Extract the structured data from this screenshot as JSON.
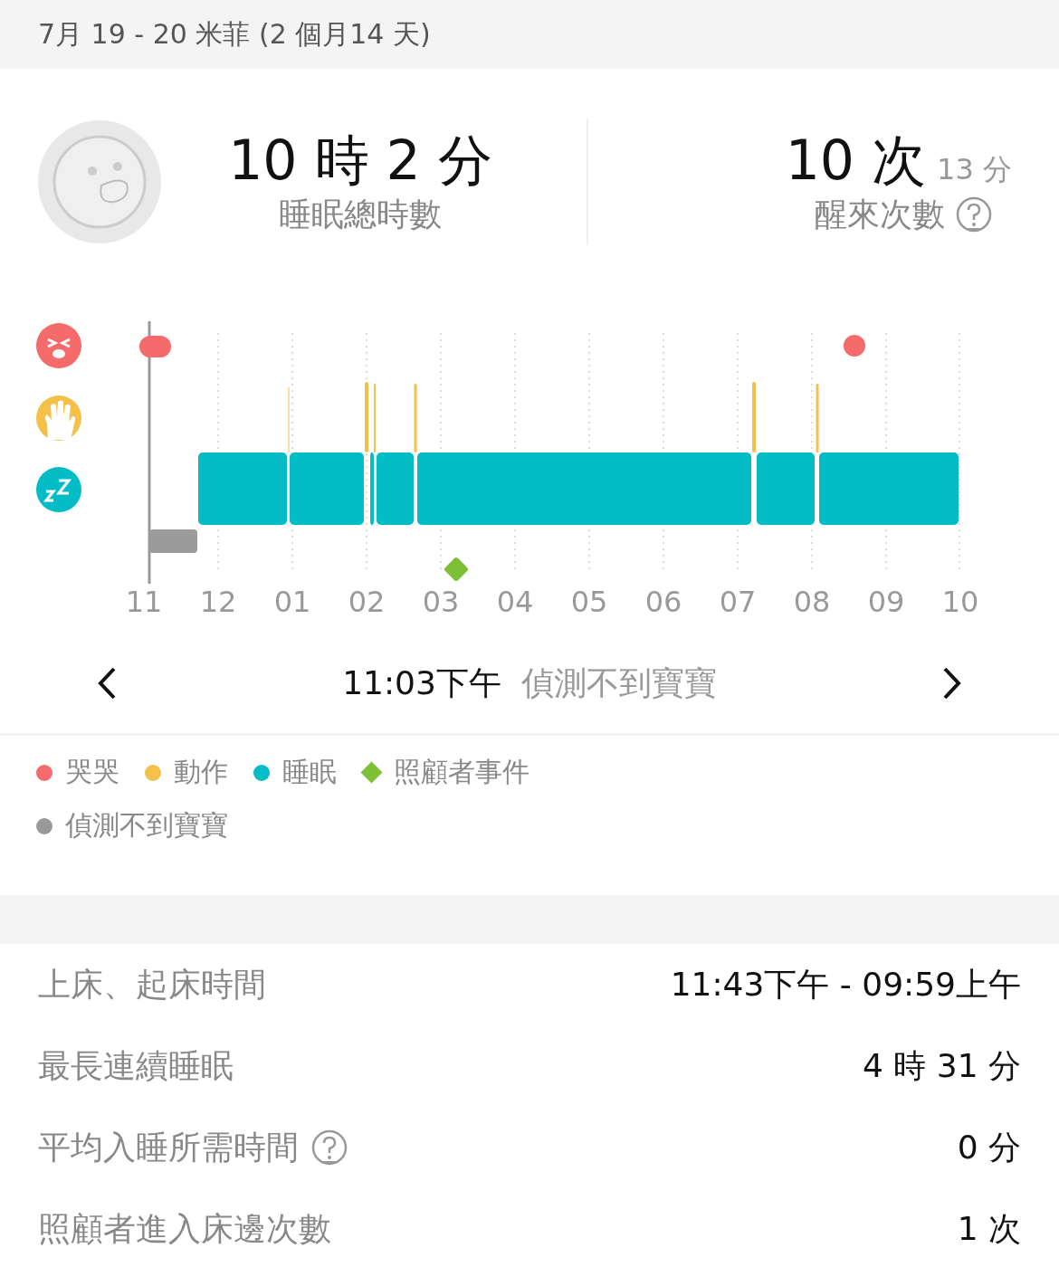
{
  "header": {
    "title": "7月 19 - 20 米菲 (2 個月14 天)"
  },
  "summary": {
    "total_sleep": {
      "value": "10 時 2 分",
      "label": "睡眠總時數"
    },
    "wakeups": {
      "value": "10 次",
      "duration": "13 分",
      "label": "醒來次數",
      "help": true
    }
  },
  "timeline": {
    "hour_labels": [
      "11",
      "12",
      "01",
      "02",
      "03",
      "04",
      "05",
      "06",
      "07",
      "08",
      "09",
      "10"
    ]
  },
  "navigator": {
    "time": "11:03下午",
    "status": "偵測不到寶寶"
  },
  "legend": [
    {
      "label": "哭哭",
      "kind": "dot",
      "color": "#f56a6a"
    },
    {
      "label": "動作",
      "kind": "dot",
      "color": "#f5c04a"
    },
    {
      "label": "睡眠",
      "kind": "dot",
      "color": "#03bcc6"
    },
    {
      "label": "照顧者事件",
      "kind": "diamond",
      "color": "#7dbf35"
    },
    {
      "label": "偵測不到寶寶",
      "kind": "dot",
      "color": "#999999"
    }
  ],
  "stats": [
    {
      "label": "上床、起床時間",
      "value": "11:43下午 - 09:59上午",
      "help": false
    },
    {
      "label": "最長連續睡眠",
      "value": "4 時 31 分",
      "help": false
    },
    {
      "label": "平均入睡所需時間",
      "value": "0 分",
      "help": true
    },
    {
      "label": "照顧者進入床邊次數",
      "value": "1 次",
      "help": false
    }
  ]
}
